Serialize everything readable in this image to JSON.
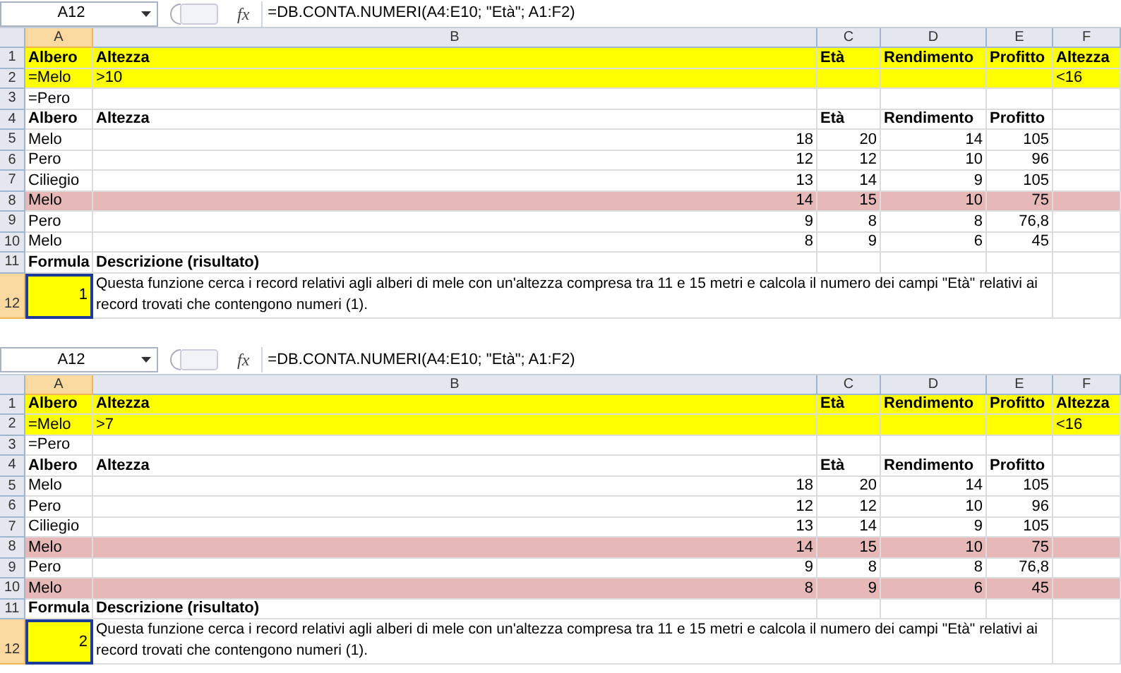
{
  "sheets": [
    {
      "name_box": "A12",
      "fx_label": "fx",
      "formula": "=DB.CONTA.NUMERI(A4:E10; \"Età\"; A1:F2)",
      "columns": [
        {
          "label": "A",
          "selected": true
        },
        {
          "label": "B",
          "selected": false
        },
        {
          "label": "C",
          "selected": false
        },
        {
          "label": "D",
          "selected": false
        },
        {
          "label": "E",
          "selected": false
        },
        {
          "label": "F",
          "selected": false
        }
      ],
      "rows": [
        {
          "number": "1",
          "kind": "header",
          "selected": false,
          "color": "#ffff00",
          "cells": {
            "A": {
              "text": "Albero"
            },
            "B": {
              "text": "Altezza"
            },
            "C": {
              "text": "Età"
            },
            "D": {
              "text": "Rendimento"
            },
            "E": {
              "text": "Profitto"
            },
            "F": {
              "text": "Altezza"
            }
          }
        },
        {
          "number": "2",
          "kind": "criteria",
          "selected": false,
          "color": "#ffff00",
          "cells": {
            "A": {
              "text": "=Melo"
            },
            "B": {
              "text": ">10"
            },
            "F": {
              "text": "<16"
            }
          }
        },
        {
          "number": "3",
          "kind": "criteria",
          "selected": false,
          "cells": {
            "A": {
              "text": "=Pero"
            }
          }
        },
        {
          "number": "4",
          "kind": "header",
          "selected": false,
          "cells": {
            "A": {
              "text": "Albero"
            },
            "B": {
              "text": "Altezza"
            },
            "C": {
              "text": "Età"
            },
            "D": {
              "text": "Rendimento"
            },
            "E": {
              "text": "Profitto"
            }
          }
        },
        {
          "number": "5",
          "kind": "data",
          "selected": false,
          "cells": {
            "A": {
              "text": "Melo"
            },
            "B": {
              "text": "18"
            },
            "C": {
              "text": "20"
            },
            "D": {
              "text": "14"
            },
            "E": {
              "text": "105"
            }
          }
        },
        {
          "number": "6",
          "kind": "data",
          "selected": false,
          "cells": {
            "A": {
              "text": "Pero"
            },
            "B": {
              "text": "12"
            },
            "C": {
              "text": "12"
            },
            "D": {
              "text": "10"
            },
            "E": {
              "text": "96"
            }
          }
        },
        {
          "number": "7",
          "kind": "data",
          "selected": false,
          "cells": {
            "A": {
              "text": "Ciliegio"
            },
            "B": {
              "text": "13"
            },
            "C": {
              "text": "14"
            },
            "D": {
              "text": "9"
            },
            "E": {
              "text": "105"
            }
          }
        },
        {
          "number": "8",
          "kind": "data",
          "selected": false,
          "color": "#e6b8b7",
          "cells": {
            "A": {
              "text": "Melo"
            },
            "B": {
              "text": "14"
            },
            "C": {
              "text": "15"
            },
            "D": {
              "text": "10"
            },
            "E": {
              "text": "75"
            }
          }
        },
        {
          "number": "9",
          "kind": "data",
          "selected": false,
          "cells": {
            "A": {
              "text": "Pero"
            },
            "B": {
              "text": "9"
            },
            "C": {
              "text": "8"
            },
            "D": {
              "text": "8"
            },
            "E": {
              "text": "76,8"
            }
          }
        },
        {
          "number": "10",
          "kind": "data",
          "selected": false,
          "cells": {
            "A": {
              "text": "Melo"
            },
            "B": {
              "text": "8"
            },
            "C": {
              "text": "9"
            },
            "D": {
              "text": "6"
            },
            "E": {
              "text": "45"
            }
          }
        },
        {
          "number": "11",
          "kind": "header",
          "selected": false,
          "cells": {
            "A": {
              "text": "Formula"
            },
            "B": {
              "text": "Descrizione (risultato)"
            }
          }
        },
        {
          "number": "12",
          "kind": "result",
          "selected": true,
          "cells": {
            "A": {
              "text": "1",
              "color": "#ffff00"
            },
            "B": {
              "text": "Questa funzione cerca i record relativi agli alberi di mele con un'altezza compresa tra 11 e 15 metri e calcola il numero dei campi \"Età\" relativi ai record trovati che contengono numeri (1)."
            }
          }
        }
      ]
    },
    {
      "name_box": "A12",
      "fx_label": "fx",
      "formula": "=DB.CONTA.NUMERI(A4:E10; \"Età\"; A1:F2)",
      "columns": [
        {
          "label": "A",
          "selected": true
        },
        {
          "label": "B",
          "selected": false
        },
        {
          "label": "C",
          "selected": false
        },
        {
          "label": "D",
          "selected": false
        },
        {
          "label": "E",
          "selected": false
        },
        {
          "label": "F",
          "selected": false
        }
      ],
      "rows": [
        {
          "number": "1",
          "kind": "header",
          "selected": false,
          "color": "#ffff00",
          "cells": {
            "A": {
              "text": "Albero"
            },
            "B": {
              "text": "Altezza"
            },
            "C": {
              "text": "Età"
            },
            "D": {
              "text": "Rendimento"
            },
            "E": {
              "text": "Profitto"
            },
            "F": {
              "text": "Altezza"
            }
          }
        },
        {
          "number": "2",
          "kind": "criteria",
          "selected": false,
          "color": "#ffff00",
          "cells": {
            "A": {
              "text": "=Melo"
            },
            "B": {
              "text": ">7"
            },
            "F": {
              "text": "<16"
            }
          }
        },
        {
          "number": "3",
          "kind": "criteria",
          "selected": false,
          "cells": {
            "A": {
              "text": "=Pero"
            }
          }
        },
        {
          "number": "4",
          "kind": "header",
          "selected": false,
          "cells": {
            "A": {
              "text": "Albero"
            },
            "B": {
              "text": "Altezza"
            },
            "C": {
              "text": "Età"
            },
            "D": {
              "text": "Rendimento"
            },
            "E": {
              "text": "Profitto"
            }
          }
        },
        {
          "number": "5",
          "kind": "data",
          "selected": false,
          "cells": {
            "A": {
              "text": "Melo"
            },
            "B": {
              "text": "18"
            },
            "C": {
              "text": "20"
            },
            "D": {
              "text": "14"
            },
            "E": {
              "text": "105"
            }
          }
        },
        {
          "number": "6",
          "kind": "data",
          "selected": false,
          "cells": {
            "A": {
              "text": "Pero"
            },
            "B": {
              "text": "12"
            },
            "C": {
              "text": "12"
            },
            "D": {
              "text": "10"
            },
            "E": {
              "text": "96"
            }
          }
        },
        {
          "number": "7",
          "kind": "data",
          "selected": false,
          "cells": {
            "A": {
              "text": "Ciliegio"
            },
            "B": {
              "text": "13"
            },
            "C": {
              "text": "14"
            },
            "D": {
              "text": "9"
            },
            "E": {
              "text": "105"
            }
          }
        },
        {
          "number": "8",
          "kind": "data",
          "selected": false,
          "color": "#e6b8b7",
          "cells": {
            "A": {
              "text": "Melo"
            },
            "B": {
              "text": "14"
            },
            "C": {
              "text": "15"
            },
            "D": {
              "text": "10"
            },
            "E": {
              "text": "75"
            }
          }
        },
        {
          "number": "9",
          "kind": "data",
          "selected": false,
          "cells": {
            "A": {
              "text": "Pero"
            },
            "B": {
              "text": "9"
            },
            "C": {
              "text": "8"
            },
            "D": {
              "text": "8"
            },
            "E": {
              "text": "76,8"
            }
          }
        },
        {
          "number": "10",
          "kind": "data",
          "selected": false,
          "color": "#e6b8b7",
          "cells": {
            "A": {
              "text": "Melo"
            },
            "B": {
              "text": "8"
            },
            "C": {
              "text": "9"
            },
            "D": {
              "text": "6"
            },
            "E": {
              "text": "45"
            }
          }
        },
        {
          "number": "11",
          "kind": "header",
          "selected": false,
          "cells": {
            "A": {
              "text": "Formula"
            },
            "B": {
              "text": "Descrizione (risultato)"
            }
          }
        },
        {
          "number": "12",
          "kind": "result",
          "selected": true,
          "cells": {
            "A": {
              "text": "2",
              "color": "#ffff00"
            },
            "B": {
              "text": "Questa funzione cerca i record relativi agli alberi di mele con un'altezza compresa tra 11 e 15 metri e calcola il numero dei campi \"Età\" relativi ai record trovati che contengono numeri (1)."
            }
          }
        }
      ]
    }
  ]
}
